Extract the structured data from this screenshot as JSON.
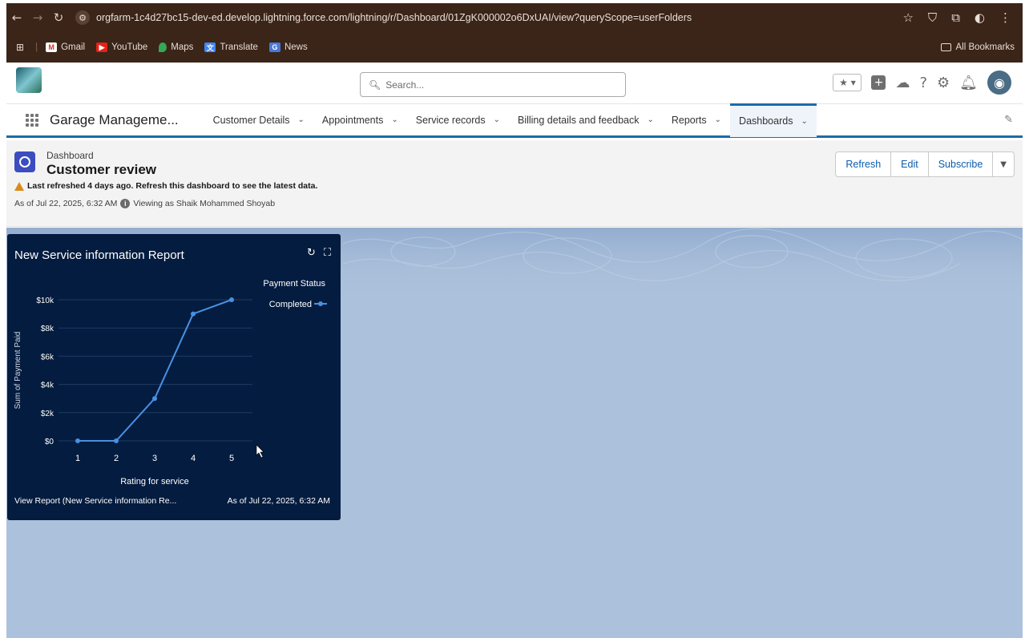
{
  "browser": {
    "url": "orgfarm-1c4d27bc15-dev-ed.develop.lightning.force.com/lightning/r/Dashboard/01ZgK000002o6DxUAI/view?queryScope=userFolders",
    "bookmarks": [
      "Gmail",
      "YouTube",
      "Maps",
      "Translate",
      "News"
    ],
    "all_bookmarks": "All Bookmarks"
  },
  "header": {
    "search_placeholder": "Search..."
  },
  "nav": {
    "app_name": "Garage Manageme...",
    "items": [
      {
        "label": "Customer Details"
      },
      {
        "label": "Appointments"
      },
      {
        "label": "Service records"
      },
      {
        "label": "Billing details and feedback"
      },
      {
        "label": "Reports"
      },
      {
        "label": "Dashboards"
      }
    ]
  },
  "dashboard": {
    "type_label": "Dashboard",
    "title": "Customer review",
    "warning": "Last refreshed 4 days ago. Refresh this dashboard to see the latest data.",
    "as_of": "As of Jul 22, 2025, 6:32 AM",
    "viewing_as": "Viewing as Shaik Mohammed Shoyab",
    "buttons": {
      "refresh": "Refresh",
      "edit": "Edit",
      "subscribe": "Subscribe"
    }
  },
  "widget": {
    "title": "New Service information Report",
    "view_report": "View Report (New Service information Re...",
    "as_of": "As of Jul 22, 2025, 6:32 AM"
  },
  "chart_data": {
    "type": "line",
    "x": [
      1,
      2,
      3,
      4,
      5
    ],
    "series": [
      {
        "name": "Completed",
        "values": [
          0,
          0,
          3000,
          9000,
          10000
        ],
        "color": "#4a90e2"
      }
    ],
    "xlabel": "Rating for service",
    "ylabel": "Sum of Payment Paid",
    "legend_title": "Payment Status",
    "yticks": [
      "$0",
      "$2k",
      "$4k",
      "$6k",
      "$8k",
      "$10k"
    ],
    "ylim": [
      0,
      10000
    ],
    "legend_position": "top-right"
  },
  "colors": {
    "browser_bg": "#3b2418",
    "nav_accent": "#1b6ca8",
    "widget_bg": "#041c3f",
    "canvas_bg": "#acc1db",
    "button_text": "#0b5cab"
  }
}
